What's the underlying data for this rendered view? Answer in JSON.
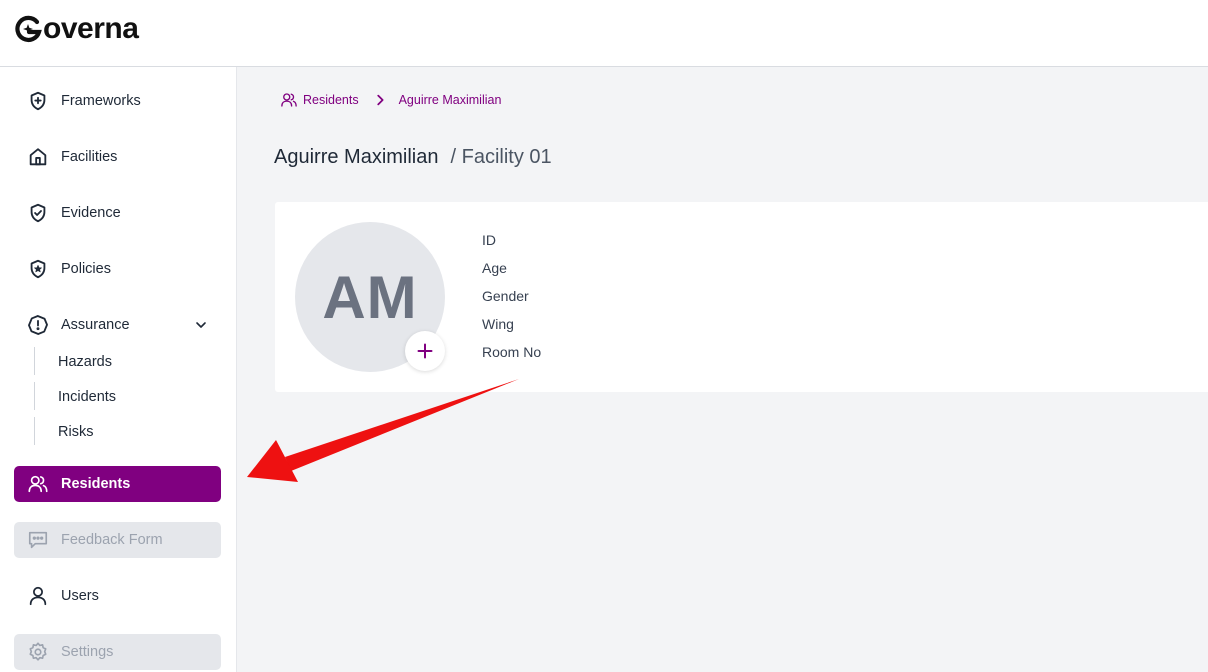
{
  "app": {
    "logo_text": "overna"
  },
  "sidebar": {
    "items": [
      {
        "label": "Frameworks",
        "icon": "shield-plus-icon"
      },
      {
        "label": "Facilities",
        "icon": "house-icon"
      },
      {
        "label": "Evidence",
        "icon": "shield-check-icon"
      },
      {
        "label": "Policies",
        "icon": "shield-star-icon"
      },
      {
        "label": "Assurance",
        "icon": "alert-octagon-icon"
      }
    ],
    "assurance_subitems": [
      "Hazards",
      "Incidents",
      "Risks"
    ],
    "residents_label": "Residents",
    "feedback_label": "Feedback Form",
    "users_label": "Users",
    "settings_label": "Settings"
  },
  "breadcrumb": {
    "root": "Residents",
    "current": "Aguirre Maximilian"
  },
  "resident": {
    "name": "Aguirre Maximilian",
    "facility": "/ Facility 01",
    "initials": "AM",
    "fields": [
      "ID",
      "Age",
      "Gender",
      "Wing",
      "Room No"
    ]
  },
  "colors": {
    "accent": "#800080",
    "annotation_arrow": "#ee1111"
  }
}
